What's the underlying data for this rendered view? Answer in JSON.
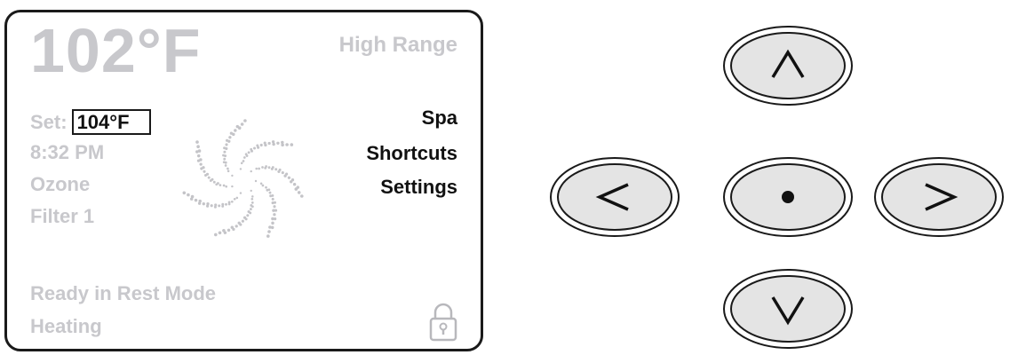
{
  "display": {
    "temperature": "102°F",
    "range": "High Range",
    "set_label": "Set:",
    "set_value": "104°F",
    "time": "8:32 PM",
    "ozone": "Ozone",
    "filter": "Filter 1",
    "status": "Ready in Rest Mode",
    "heating": "Heating",
    "menu": [
      "Spa",
      "Shortcuts",
      "Settings"
    ]
  },
  "icons": {
    "swirl": "swirl-icon",
    "lock": "lock-icon"
  },
  "keypad": {
    "up": "up-arrow-icon",
    "left": "left-arrow-icon",
    "ok": "dot-icon",
    "right": "right-arrow-icon",
    "down": "down-arrow-icon"
  },
  "colors": {
    "dim_text": "#c8c8cc",
    "active_text": "#111111",
    "button_fill": "#e4e4e4",
    "outline": "#1a1a1a"
  }
}
